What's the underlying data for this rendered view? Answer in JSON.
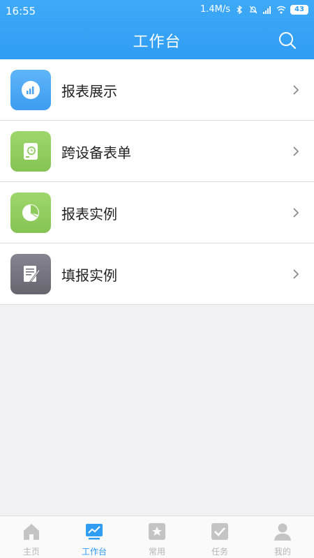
{
  "status": {
    "time": "16:55",
    "speed": "1.4M/s",
    "battery": "43"
  },
  "header": {
    "title": "工作台",
    "search_icon": "search-icon"
  },
  "items": [
    {
      "label": "报表展示",
      "icon": "bar-chart-icon",
      "color": "#4aa6f4"
    },
    {
      "label": "跨设备表单",
      "icon": "device-clock-icon",
      "color": "#8fcb5c"
    },
    {
      "label": "报表实例",
      "icon": "pie-chart-icon",
      "color": "#8fcb5c"
    },
    {
      "label": "填报实例",
      "icon": "edit-document-icon",
      "color": "#74737f"
    }
  ],
  "tabs": [
    {
      "label": "主页",
      "icon": "home-icon",
      "active": false
    },
    {
      "label": "工作台",
      "icon": "dashboard-icon",
      "active": true
    },
    {
      "label": "常用",
      "icon": "star-icon",
      "active": false
    },
    {
      "label": "任务",
      "icon": "checkbox-icon",
      "active": false
    },
    {
      "label": "我的",
      "icon": "user-icon",
      "active": false
    }
  ],
  "colors": {
    "accent": "#2f9df3",
    "inactive_tab": "#b5b5b5",
    "background": "#f2f2f6"
  }
}
